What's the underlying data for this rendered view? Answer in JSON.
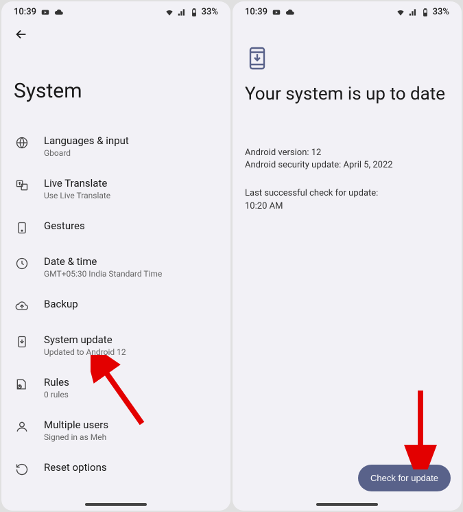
{
  "status": {
    "time": "10:39",
    "battery": "33%"
  },
  "left": {
    "title": "System",
    "items": [
      {
        "title": "Languages & input",
        "sub": "Gboard"
      },
      {
        "title": "Live Translate",
        "sub": "Use Live Translate"
      },
      {
        "title": "Gestures",
        "sub": ""
      },
      {
        "title": "Date & time",
        "sub": "GMT+05:30 India Standard Time"
      },
      {
        "title": "Backup",
        "sub": ""
      },
      {
        "title": "System update",
        "sub": "Updated to Android 12"
      },
      {
        "title": "Rules",
        "sub": "0 rules"
      },
      {
        "title": "Multiple users",
        "sub": "Signed in as Meh"
      },
      {
        "title": "Reset options",
        "sub": ""
      }
    ]
  },
  "right": {
    "title": "Your system is up to date",
    "version_line": "Android version: 12",
    "security_line": "Android security update: April 5, 2022",
    "lastcheck_label": "Last successful check for update:",
    "lastcheck_time": "10:20 AM",
    "button": "Check for update"
  }
}
